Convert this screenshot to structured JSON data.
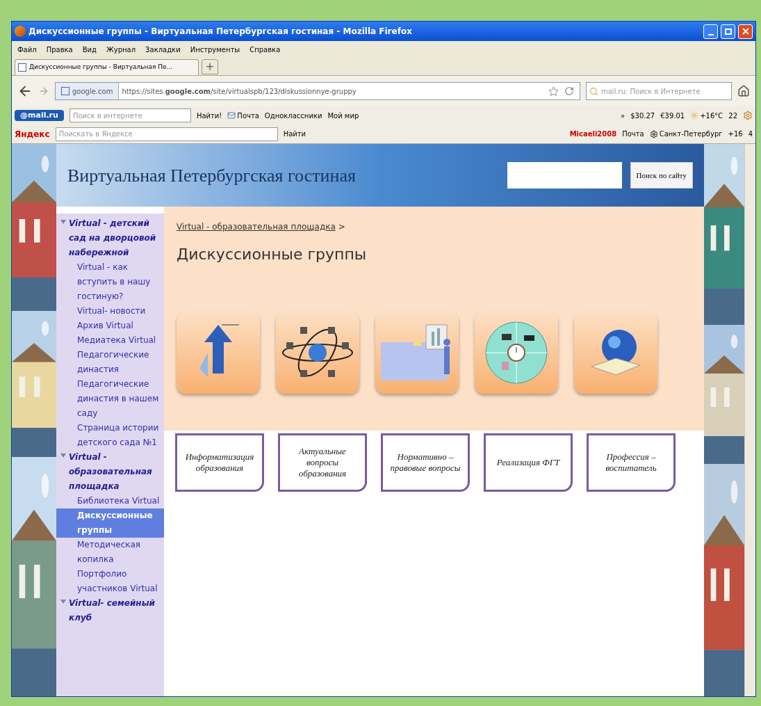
{
  "window": {
    "title": "Дискуссионные группы - Виртуальная Петербургская гостиная - Mozilla Firefox"
  },
  "menu": [
    "Файл",
    "Правка",
    "Вид",
    "Журнал",
    "Закладки",
    "Инструменты",
    "Справка"
  ],
  "tabs": [
    {
      "label": "Дискуссионные группы - Виртуальная Пе...",
      "selected": true
    }
  ],
  "new_tab": "+",
  "address_bar": {
    "site": "google.com",
    "url": "https://sites.**google.com**/site/virtualspb/123/diskussionnye-gruppy"
  },
  "search_bar": {
    "placeholder": "mail.ru: Поиск в Интернете"
  },
  "mail_toolbar": {
    "logo": "@mail.ru",
    "placeholder": "Поиск в интернете",
    "button": "Найти!",
    "links": [
      "Почта",
      "Одноклассники",
      "Мой мир"
    ],
    "more": "»",
    "dollar": "$30.27",
    "euro": "€39.01",
    "weather": "+16°C",
    "count": "22"
  },
  "yandex_toolbar": {
    "logo": "Яндекс",
    "placeholder": "Поискать в Яндексе",
    "button": "Найти",
    "user": "Micaeli2008",
    "mail": "Почта",
    "city": "Санкт-Петербург",
    "temp": "+16",
    "count": "4"
  },
  "site": {
    "title": "Виртуальная Петербургская гостиная",
    "search_button": "Поиск по сайту",
    "breadcrumb": "Virtual - образовательная площадка",
    "breadcrumb_sep": ">",
    "heading": "Дискуссионные группы"
  },
  "sidebar": [
    {
      "label": "Virtual - детский сад на дворцовой набережной",
      "expanded": true,
      "selected": false,
      "children": [
        {
          "label": "Virtual - как вступить в нашу гостиную?",
          "selected": false
        },
        {
          "label": "Virtual- новости",
          "selected": false
        },
        {
          "label": "Архив Virtual",
          "selected": false
        },
        {
          "label": "Медиатека Virtual",
          "selected": false
        },
        {
          "label": "Педагогические династия",
          "selected": false
        },
        {
          "label": "Педагогические династия в нашем саду",
          "selected": false
        },
        {
          "label": "Страница истории детского сада №1",
          "selected": false
        }
      ]
    },
    {
      "label": "Virtual - образовательная площадка",
      "expanded": true,
      "selected": false,
      "children": [
        {
          "label": "Библиотека Virtual",
          "selected": false
        },
        {
          "label": "Дискуссионные группы",
          "selected": true
        },
        {
          "label": "Методическая копилка",
          "selected": false
        },
        {
          "label": "Портфолио участников Virtual",
          "selected": false
        }
      ]
    },
    {
      "label": "Virtual- семейный клуб",
      "expanded": true,
      "selected": false
    }
  ],
  "tiles": [
    {
      "label": "Информатизация образования"
    },
    {
      "label": "Актуальные вопросы образования"
    },
    {
      "label": "Нормативно – правовые вопросы"
    },
    {
      "label": "Реализация ФГТ"
    },
    {
      "label": "Профессия – воспитатель"
    }
  ]
}
